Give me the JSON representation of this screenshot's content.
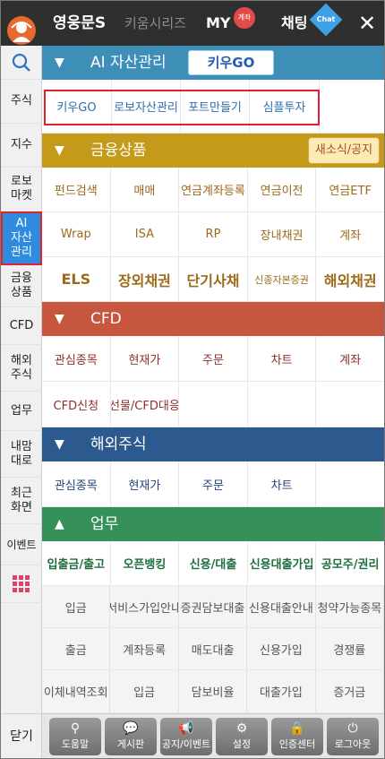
{
  "header": {
    "title": "영웅문S",
    "tabs": [
      "키움시리즈",
      "MY",
      "채팅"
    ],
    "my_badge": "계좌",
    "chat_badge": "Chat"
  },
  "sidebar": {
    "items": [
      "주식",
      "지수",
      "로보\n마켓",
      "AI\n자산\n관리",
      "금융\n상품",
      "CFD",
      "해외\n주식",
      "업무",
      "내맘\n대로",
      "최근\n화면",
      "이벤트"
    ],
    "close_label": "닫기"
  },
  "sections": {
    "ai": {
      "title": "AI 자산관리",
      "logo": "키우GO",
      "items": [
        "키우GO",
        "로보자산관리",
        "포트만들기",
        "심플투자"
      ]
    },
    "finance": {
      "title": "금융상품",
      "notice_button": "새소식/공지",
      "rows": [
        [
          "펀드검색",
          "매매",
          "연금계좌등록",
          "연금이전",
          "연금ETF"
        ],
        [
          "Wrap",
          "ISA",
          "RP",
          "장내채권",
          "계좌"
        ],
        [
          "ELS",
          "장외채권",
          "단기사채",
          "신종자본증권",
          "해외채권"
        ]
      ]
    },
    "cfd": {
      "title": "CFD",
      "rows": [
        [
          "관심종목",
          "현재가",
          "주문",
          "차트",
          "계좌"
        ],
        [
          "CFD신청",
          "선물/CFD대응",
          "",
          "",
          ""
        ]
      ]
    },
    "overseas": {
      "title": "해외주식",
      "rows": [
        [
          "관심종목",
          "현재가",
          "주문",
          "차트",
          ""
        ]
      ]
    },
    "work": {
      "title": "업무",
      "main_row": [
        "입출금/출고",
        "오픈뱅킹",
        "신용/대출",
        "신용대출가입",
        "공모주/권리"
      ],
      "rows": [
        [
          "입금",
          "서비스가입안내",
          "증권담보대출",
          "신용대출안내",
          "청약가능종목"
        ],
        [
          "출금",
          "계좌등록",
          "매도대출",
          "신용가입",
          "경쟁률"
        ],
        [
          "이체내역조회",
          "입금",
          "담보비율",
          "대출가입",
          "증거금"
        ]
      ]
    }
  },
  "bottom_bar": [
    "도움말",
    "게시판",
    "공지/이벤트",
    "설정",
    "인증센터",
    "로그아웃"
  ],
  "colors": {
    "topbar": "#2f2f2f",
    "ai_header": "#3d8fb8",
    "finance_header": "#c39a1a",
    "cfd_header": "#c6563e",
    "overseas_header": "#2d5a8e",
    "work_header": "#35905a",
    "sidebar_active": "#2e8be0",
    "highlight_box": "#e0222a"
  }
}
